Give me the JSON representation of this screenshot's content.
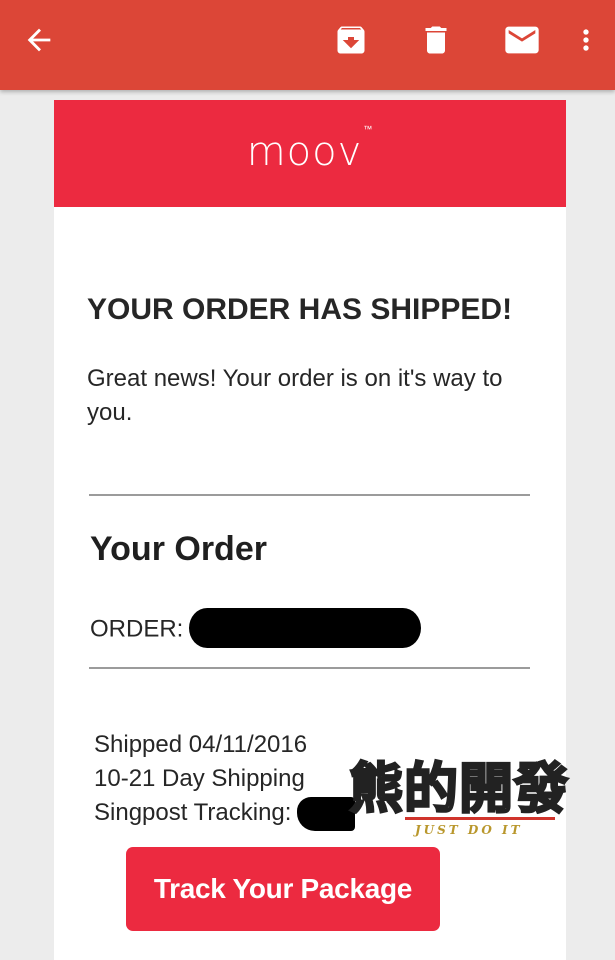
{
  "toolbar": {
    "back_icon": "arrow-back-icon",
    "archive_icon": "archive-icon",
    "delete_icon": "delete-icon",
    "mark_unread_icon": "mail-icon",
    "more_icon": "more-vert-icon",
    "bar_color": "#dc4637"
  },
  "email": {
    "brand": {
      "name": "moov",
      "trademark": "™",
      "color": "#ec2a40"
    },
    "headline": "YOUR ORDER HAS SHIPPED!",
    "intro": "Great news! Your order is on it's way to you.",
    "order_section": {
      "title": "Your Order",
      "order_label": "ORDER:"
    },
    "shipping": {
      "shipped_line": "Shipped 04/11/2016",
      "method_line": "10-21 Day Shipping",
      "tracking_label": "Singpost Tracking:"
    },
    "track_button_label": "Track Your Package"
  },
  "watermark": {
    "main_text": "熊的開發",
    "sub_text": "JUST DO IT"
  }
}
